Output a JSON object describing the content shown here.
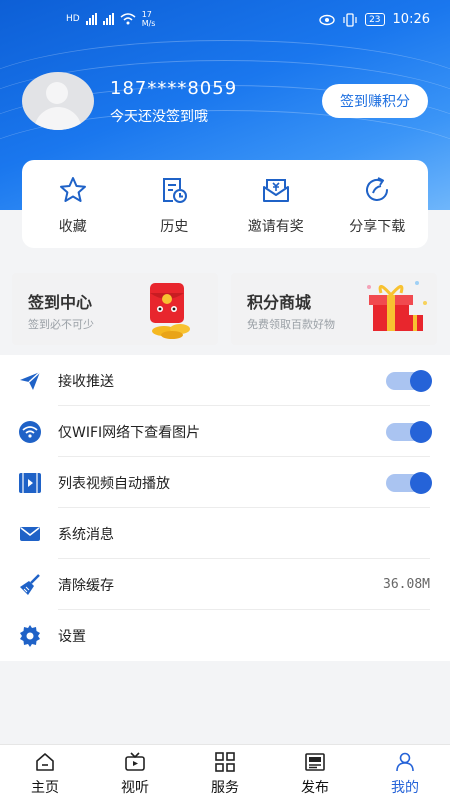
{
  "status_bar": {
    "net_speed": "17",
    "net_unit": "M/s",
    "battery": "23",
    "time": "10:26"
  },
  "profile": {
    "phone": "187****8059",
    "hint": "今天还没签到哦",
    "signin_button": "签到赚积分"
  },
  "quick_actions": [
    {
      "label": "收藏",
      "icon": "star-icon"
    },
    {
      "label": "历史",
      "icon": "history-icon"
    },
    {
      "label": "邀请有奖",
      "icon": "invite-gift-icon"
    },
    {
      "label": "分享下载",
      "icon": "share-icon"
    }
  ],
  "promos": [
    {
      "title": "签到中心",
      "subtitle": "签到必不可少"
    },
    {
      "title": "积分商城",
      "subtitle": "免费领取百款好物"
    }
  ],
  "settings": [
    {
      "label": "接收推送",
      "icon": "send-icon",
      "toggle": true
    },
    {
      "label": "仅WIFI网络下查看图片",
      "icon": "wifi-icon",
      "toggle": true
    },
    {
      "label": "列表视频自动播放",
      "icon": "video-icon",
      "toggle": true
    },
    {
      "label": "系统消息",
      "icon": "mail-icon"
    },
    {
      "label": "清除缓存",
      "icon": "broom-icon",
      "value": "36.08M"
    },
    {
      "label": "设置",
      "icon": "gear-icon"
    }
  ],
  "tabs": [
    {
      "label": "主页",
      "icon": "home-icon"
    },
    {
      "label": "视听",
      "icon": "tv-icon"
    },
    {
      "label": "服务",
      "icon": "grid-icon"
    },
    {
      "label": "发布",
      "icon": "publish-icon"
    },
    {
      "label": "我的",
      "icon": "user-icon",
      "active": true
    }
  ],
  "colors": {
    "accent": "#2563d8",
    "header": "#1a77ee",
    "toggle_track": "#aac4f1"
  }
}
